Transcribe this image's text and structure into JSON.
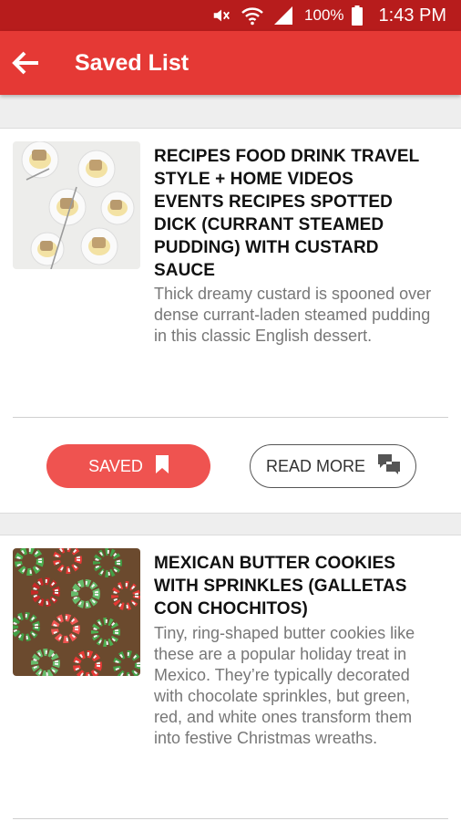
{
  "status_bar": {
    "battery": "100%",
    "time": "1:43 PM"
  },
  "app_bar": {
    "title": "Saved List"
  },
  "items": [
    {
      "title": "RECIPES   FOOD   DRINK TRAVEL   STYLE + HOME VIDEOS   EVENTS RECIPES SPOTTED DICK (CURRANT STEAMED PUDDING) WITH CUSTARD SAUCE",
      "description": "Thick dreamy custard is spooned over dense currant-laden steamed pudding in this classic English dessert.",
      "saved_label": "SAVED",
      "read_more_label": "READ MORE"
    },
    {
      "title": "MEXICAN BUTTER COOKIES WITH SPRINKLES (GALLETAS CON CHOCHITOS)",
      "description": "Tiny, ring-shaped butter cookies like these are a popular holiday treat in Mexico. They’re typically decorated with chocolate sprinkles, but green, red, and white ones transform them into festive Christmas wreaths."
    }
  ],
  "colors": {
    "status_bar": "#b71c1c",
    "app_bar": "#e53935",
    "saved_button": "#ef5350"
  },
  "icons": [
    "mute-icon",
    "wifi-icon",
    "signal-icon",
    "battery-icon",
    "back-arrow-icon",
    "bookmark-icon",
    "comments-icon"
  ]
}
